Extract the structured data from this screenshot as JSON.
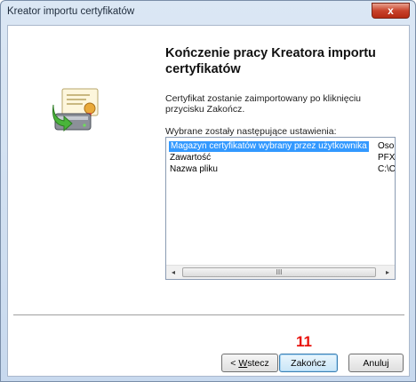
{
  "window": {
    "title": "Kreator importu certyfikatów",
    "close_label": "x"
  },
  "wizard": {
    "heading": "Kończenie pracy Kreatora importu certyfikatów",
    "description": "Certyfikat zostanie zaimportowany po kliknięciu przycisku Zakończ.",
    "settings_label": "Wybrane zostały następujące ustawienia:",
    "settings": [
      {
        "name": "Magazyn certyfikatów wybrany przez użytkownika",
        "value": "Osob",
        "selected": true
      },
      {
        "name": "Zawartość",
        "value": "PFX",
        "selected": false
      },
      {
        "name": "Nazwa pliku",
        "value": "C:\\Ce",
        "selected": false
      }
    ],
    "scroll_left": "◂",
    "scroll_thumb": "III",
    "scroll_right": "▸"
  },
  "annotation": {
    "step_number": "11"
  },
  "buttons": {
    "back_prefix": "< ",
    "back_mnemonic": "W",
    "back_rest": "stecz",
    "finish_label": "Zakończ",
    "cancel_label": "Anuluj"
  },
  "colors": {
    "selection": "#3399ff",
    "annotation": "#e8120c",
    "close_button": "#c8432c"
  }
}
